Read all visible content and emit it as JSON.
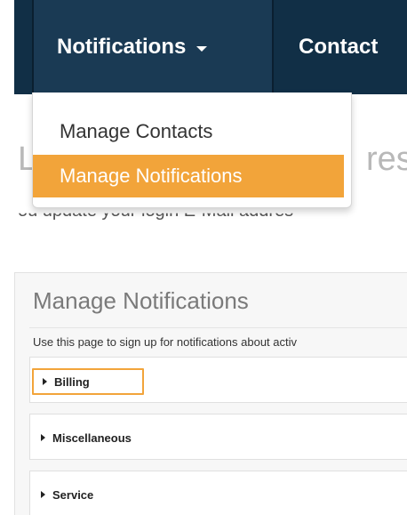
{
  "navbar": {
    "items": [
      {
        "label": "Notifications",
        "has_dropdown": true,
        "active": true
      },
      {
        "label": "Contact"
      }
    ]
  },
  "dropdown": {
    "items": [
      {
        "label": "Manage Contacts"
      },
      {
        "label": "Manage Notifications",
        "highlighted": true
      }
    ]
  },
  "background_page": {
    "heading_left": "L",
    "heading_right": "res",
    "subtext": "ou update your login E-Mail addres"
  },
  "panel": {
    "title": "Manage Notifications",
    "description": "Use this page to sign up for notifications about activ",
    "sections": [
      {
        "label": "Billing",
        "focused": true,
        "expanded": false
      },
      {
        "label": "Miscellaneous",
        "expanded": false
      },
      {
        "label": "Service",
        "expanded": false
      }
    ]
  },
  "colors": {
    "navbar_bg": "#112f46",
    "accent_orange": "#f2a43a",
    "panel_bg": "#f7f7f7"
  },
  "icons": {
    "nav_caret": "caret-down-icon",
    "section_toggle": "triangle-right-icon"
  }
}
